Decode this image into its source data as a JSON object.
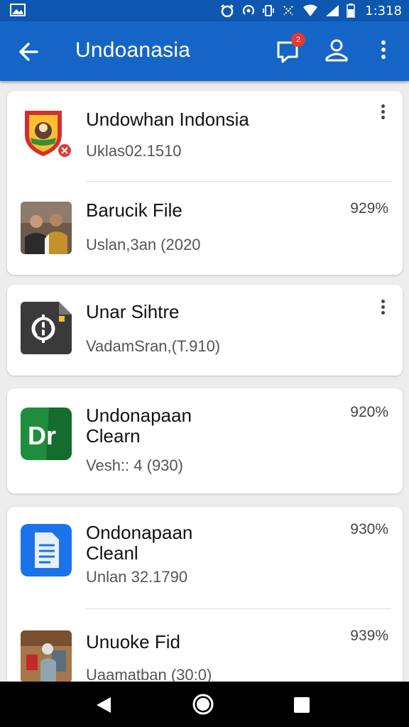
{
  "status_bar": {
    "time": "1:318",
    "icons": [
      "gallery-icon",
      "alarm-icon",
      "hotspot-icon",
      "vibrate-icon",
      "nfc-icon",
      "wifi-icon",
      "signal-icon",
      "battery-icon"
    ]
  },
  "app_bar": {
    "title": "Undoanasia",
    "notification_badge": "2",
    "icons": [
      "back-arrow-icon",
      "notification-icon",
      "account-icon",
      "more-vert-icon"
    ]
  },
  "cards": [
    {
      "items": [
        {
          "title": "Undowhan Indonsia",
          "subtitle": "Uklas02.1510",
          "percent": "",
          "icon": "garuda-emblem-icon",
          "has_menu": true
        },
        {
          "title": "Barucik File",
          "subtitle": "Uslan,3an (2020",
          "percent": "929%",
          "icon": "people-photo-thumbnail",
          "has_menu": false
        }
      ]
    },
    {
      "items": [
        {
          "title": "Unar Sihtre",
          "subtitle": "VadamSran,(T.910)",
          "percent": "",
          "icon": "dollar-file-icon",
          "has_menu": true
        }
      ]
    },
    {
      "items": [
        {
          "title": "Undonapaan\nClearn",
          "subtitle": "Vesh:: 4 (930)",
          "percent": "920%",
          "icon": "dr-app-icon",
          "has_menu": false
        }
      ]
    },
    {
      "items": [
        {
          "title": "Ondonapaan\nCleanl",
          "subtitle": "Unlan 32.1790",
          "percent": "930%",
          "icon": "docs-icon",
          "has_menu": false
        },
        {
          "title": "Unuoke Fid",
          "subtitle": "Uaamatban (30:0)",
          "percent": "939%",
          "icon": "room-photo-thumbnail",
          "has_menu": false
        }
      ]
    }
  ],
  "nav_bar": {
    "icons": [
      "nav-back-icon",
      "nav-home-icon",
      "nav-recents-icon"
    ]
  },
  "colors": {
    "status_bar": "#0d57b0",
    "app_bar": "#1565c6",
    "badge": "#e53935",
    "background": "#ededed"
  }
}
